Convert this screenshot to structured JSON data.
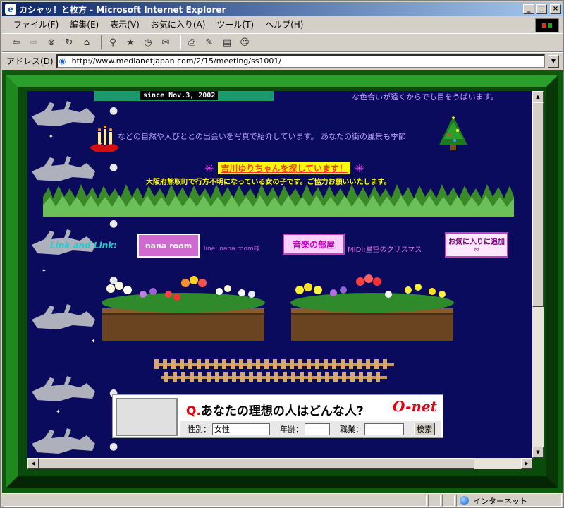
{
  "window": {
    "title": "カシャッ！と枚方 - Microsoft Internet Explorer",
    "min_label": "_",
    "max_label": "□",
    "close_label": "×"
  },
  "menu": [
    "ファイル(F)",
    "編集(E)",
    "表示(V)",
    "お気に入り(A)",
    "ツール(T)",
    "ヘルプ(H)"
  ],
  "toolbar": {
    "icons": [
      "back-icon",
      "forward-icon",
      "stop-icon",
      "refresh-icon",
      "home-icon",
      "search-icon",
      "favorites-icon",
      "history-icon",
      "mail-icon",
      "print-icon",
      "edit-icon",
      "discuss-icon",
      "messenger-icon"
    ]
  },
  "address": {
    "label": "アドレス(D)",
    "url": "http://www.medianetjapan.com/2/15/meeting/ss1001/"
  },
  "page": {
    "since": "since Nov.3, 2002",
    "top_right": "な色合いが遠くからでも目をうばいます。",
    "intro": "などの自然や人びととの出会いを写真で紹介しています。 あなたの街の風景も季節",
    "search_link": "吉川ゆりちゃんを探しています！",
    "missing_notice": "大阪府熊取町で行方不明になっている女の子です。ご協力お願いいたします。",
    "links_label": "Link and Link:",
    "nana_banner": "nana room",
    "nana_caption": "line: nana room様",
    "music_banner": "音楽の部屋",
    "music_caption": "MIDI:星空のクリスマス",
    "fav_banner": "お気に入りに追加"
  },
  "ad": {
    "question_prefix": "Q.",
    "question": "あなたの理想の人はどんな人?",
    "logo": "O-net",
    "gender_label": "性別：",
    "gender_value": "女性",
    "age_label": "年齢：",
    "job_label": "職業：",
    "search_button": "検索"
  },
  "status": {
    "zone": "インターネット"
  },
  "colors": {
    "page_bg": "#0b0b5e",
    "frame_green": "#1e8a1e",
    "link_red": "#ff3333",
    "accent_yellow": "#ffff00"
  }
}
